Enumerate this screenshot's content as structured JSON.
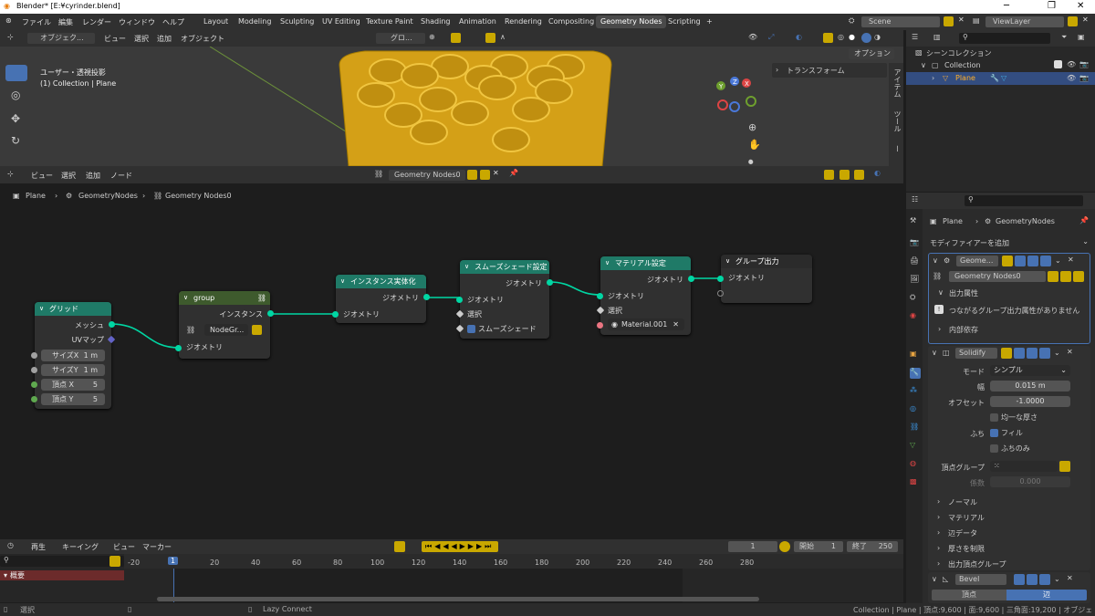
{
  "window": {
    "title": "Blender* [E:¥cyrinder.blend]",
    "minimize": "─",
    "maximize": "❐",
    "close": "✕"
  },
  "menu": {
    "items": [
      "ファイル",
      "編集",
      "レンダー",
      "ウィンドウ",
      "ヘルプ"
    ],
    "workspaces": [
      "Layout",
      "Modeling",
      "Sculpting",
      "UV Editing",
      "Texture Paint",
      "Shading",
      "Animation",
      "Rendering",
      "Compositing",
      "Geometry Nodes",
      "Scripting"
    ],
    "active_workspace": "Geometry Nodes",
    "add_workspace": "+",
    "scene": "Scene",
    "view_layer": "ViewLayer"
  },
  "viewport": {
    "mode": "オブジェク...",
    "menus": [
      "ビュー",
      "選択",
      "追加",
      "オブジェクト"
    ],
    "transform_orientation": "グロ...",
    "view_name": "ユーザー・透視投影",
    "collection_info": "(1) Collection | Plane",
    "options": "オプション",
    "transform_panel": "トランスフォーム",
    "side_tabs": [
      "アイテム",
      "ツール",
      "ビュー"
    ],
    "gizmo": {
      "x": "X",
      "y": "Y",
      "z": "Z"
    }
  },
  "node_editor": {
    "menus": [
      "ビュー",
      "選択",
      "追加",
      "ノード"
    ],
    "tree_name": "Geometry Nodes0",
    "breadcrumb": [
      "Plane",
      "GeometryNodes",
      "Geometry Nodes0"
    ],
    "nodes": {
      "grid": {
        "title": "グリッド",
        "out_mesh": "メッシュ",
        "out_uv": "UVマップ",
        "fields": [
          {
            "label": "サイズX",
            "value": "1 m"
          },
          {
            "label": "サイズY",
            "value": "1 m"
          },
          {
            "label": "頂点 X",
            "value": "5"
          },
          {
            "label": "頂点 Y",
            "value": "5"
          }
        ]
      },
      "group": {
        "title": "group",
        "out_instance": "インスタンス",
        "datablock": "NodeGr...",
        "in_geometry": "ジオメトリ"
      },
      "realize": {
        "title": "インスタンス実体化",
        "out_geometry": "ジオメトリ",
        "in_geometry": "ジオメトリ"
      },
      "smooth": {
        "title": "スムーズシェード設定",
        "out_geometry": "ジオメトリ",
        "in_geometry": "ジオメトリ",
        "in_selection": "選択",
        "in_shade_smooth": "スムーズシェード"
      },
      "material": {
        "title": "マテリアル設定",
        "out_geometry": "ジオメトリ",
        "in_geometry": "ジオメトリ",
        "in_selection": "選択",
        "material": "Material.001"
      },
      "output": {
        "title": "グループ出力",
        "in_geometry": "ジオメトリ"
      }
    }
  },
  "timeline": {
    "menus": [
      "再生",
      "キーイング",
      "ビュー",
      "マーカー"
    ],
    "current_frame": "1",
    "start_label": "開始",
    "start": "1",
    "end_label": "終了",
    "end": "250",
    "ticks": [
      "-20",
      "1",
      "20",
      "40",
      "60",
      "80",
      "100",
      "120",
      "140",
      "160",
      "180",
      "200",
      "220",
      "240",
      "260",
      "280"
    ],
    "summary": "概要"
  },
  "status": {
    "select": "選択",
    "lazy": "Lazy Connect",
    "stats": "Collection | Plane | 頂点:9,600 | 面:9,600 | 三角面:19,200 | オブジェクト:1/1"
  },
  "outliner": {
    "scene_collection": "シーンコレクション",
    "collection": "Collection",
    "object": "Plane"
  },
  "properties": {
    "breadcrumb": [
      "Plane",
      "GeometryNodes"
    ],
    "add_modifier": "モディファイアーを追加",
    "geo_mod": {
      "name": "Geome...",
      "tree": "Geometry Nodes0",
      "output_attrs": "出力属性",
      "info": "つながるグループ出力属性がありません",
      "internal_deps": "内部依存"
    },
    "solidify": {
      "name": "Solidify",
      "mode_label": "モード",
      "mode": "シンプル",
      "width_label": "幅",
      "width": "0.015 m",
      "offset_label": "オフセット",
      "offset": "-1.0000",
      "even": "均一な厚さ",
      "rim_label": "ふち",
      "fill": "フィル",
      "rim_only": "ふちのみ",
      "vgroup_label": "頂点グループ",
      "factor_label": "係数",
      "factor": "0.000",
      "sections": [
        "ノーマル",
        "マテリアル",
        "辺データ",
        "厚さを制限",
        "出力頂点グループ"
      ]
    },
    "bevel": {
      "name": "Bevel",
      "tab_vertex": "頂点",
      "tab_edge": "辺"
    }
  },
  "colors": {
    "accent": "#4772b3",
    "node_teal": "#1f7a67",
    "wire": "#00d6a3",
    "active_orange": "#ff8c00"
  }
}
